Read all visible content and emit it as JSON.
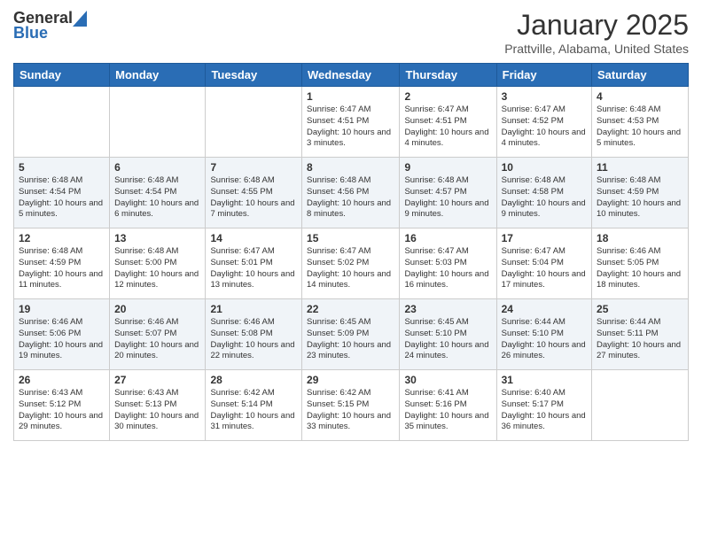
{
  "header": {
    "logo_general": "General",
    "logo_blue": "Blue",
    "month_title": "January 2025",
    "location": "Prattville, Alabama, United States"
  },
  "days_of_week": [
    "Sunday",
    "Monday",
    "Tuesday",
    "Wednesday",
    "Thursday",
    "Friday",
    "Saturday"
  ],
  "weeks": [
    [
      {
        "day": "",
        "info": ""
      },
      {
        "day": "",
        "info": ""
      },
      {
        "day": "",
        "info": ""
      },
      {
        "day": "1",
        "info": "Sunrise: 6:47 AM\nSunset: 4:51 PM\nDaylight: 10 hours\nand 3 minutes."
      },
      {
        "day": "2",
        "info": "Sunrise: 6:47 AM\nSunset: 4:51 PM\nDaylight: 10 hours\nand 4 minutes."
      },
      {
        "day": "3",
        "info": "Sunrise: 6:47 AM\nSunset: 4:52 PM\nDaylight: 10 hours\nand 4 minutes."
      },
      {
        "day": "4",
        "info": "Sunrise: 6:48 AM\nSunset: 4:53 PM\nDaylight: 10 hours\nand 5 minutes."
      }
    ],
    [
      {
        "day": "5",
        "info": "Sunrise: 6:48 AM\nSunset: 4:54 PM\nDaylight: 10 hours\nand 5 minutes."
      },
      {
        "day": "6",
        "info": "Sunrise: 6:48 AM\nSunset: 4:54 PM\nDaylight: 10 hours\nand 6 minutes."
      },
      {
        "day": "7",
        "info": "Sunrise: 6:48 AM\nSunset: 4:55 PM\nDaylight: 10 hours\nand 7 minutes."
      },
      {
        "day": "8",
        "info": "Sunrise: 6:48 AM\nSunset: 4:56 PM\nDaylight: 10 hours\nand 8 minutes."
      },
      {
        "day": "9",
        "info": "Sunrise: 6:48 AM\nSunset: 4:57 PM\nDaylight: 10 hours\nand 9 minutes."
      },
      {
        "day": "10",
        "info": "Sunrise: 6:48 AM\nSunset: 4:58 PM\nDaylight: 10 hours\nand 9 minutes."
      },
      {
        "day": "11",
        "info": "Sunrise: 6:48 AM\nSunset: 4:59 PM\nDaylight: 10 hours\nand 10 minutes."
      }
    ],
    [
      {
        "day": "12",
        "info": "Sunrise: 6:48 AM\nSunset: 4:59 PM\nDaylight: 10 hours\nand 11 minutes."
      },
      {
        "day": "13",
        "info": "Sunrise: 6:48 AM\nSunset: 5:00 PM\nDaylight: 10 hours\nand 12 minutes."
      },
      {
        "day": "14",
        "info": "Sunrise: 6:47 AM\nSunset: 5:01 PM\nDaylight: 10 hours\nand 13 minutes."
      },
      {
        "day": "15",
        "info": "Sunrise: 6:47 AM\nSunset: 5:02 PM\nDaylight: 10 hours\nand 14 minutes."
      },
      {
        "day": "16",
        "info": "Sunrise: 6:47 AM\nSunset: 5:03 PM\nDaylight: 10 hours\nand 16 minutes."
      },
      {
        "day": "17",
        "info": "Sunrise: 6:47 AM\nSunset: 5:04 PM\nDaylight: 10 hours\nand 17 minutes."
      },
      {
        "day": "18",
        "info": "Sunrise: 6:46 AM\nSunset: 5:05 PM\nDaylight: 10 hours\nand 18 minutes."
      }
    ],
    [
      {
        "day": "19",
        "info": "Sunrise: 6:46 AM\nSunset: 5:06 PM\nDaylight: 10 hours\nand 19 minutes."
      },
      {
        "day": "20",
        "info": "Sunrise: 6:46 AM\nSunset: 5:07 PM\nDaylight: 10 hours\nand 20 minutes."
      },
      {
        "day": "21",
        "info": "Sunrise: 6:46 AM\nSunset: 5:08 PM\nDaylight: 10 hours\nand 22 minutes."
      },
      {
        "day": "22",
        "info": "Sunrise: 6:45 AM\nSunset: 5:09 PM\nDaylight: 10 hours\nand 23 minutes."
      },
      {
        "day": "23",
        "info": "Sunrise: 6:45 AM\nSunset: 5:10 PM\nDaylight: 10 hours\nand 24 minutes."
      },
      {
        "day": "24",
        "info": "Sunrise: 6:44 AM\nSunset: 5:10 PM\nDaylight: 10 hours\nand 26 minutes."
      },
      {
        "day": "25",
        "info": "Sunrise: 6:44 AM\nSunset: 5:11 PM\nDaylight: 10 hours\nand 27 minutes."
      }
    ],
    [
      {
        "day": "26",
        "info": "Sunrise: 6:43 AM\nSunset: 5:12 PM\nDaylight: 10 hours\nand 29 minutes."
      },
      {
        "day": "27",
        "info": "Sunrise: 6:43 AM\nSunset: 5:13 PM\nDaylight: 10 hours\nand 30 minutes."
      },
      {
        "day": "28",
        "info": "Sunrise: 6:42 AM\nSunset: 5:14 PM\nDaylight: 10 hours\nand 31 minutes."
      },
      {
        "day": "29",
        "info": "Sunrise: 6:42 AM\nSunset: 5:15 PM\nDaylight: 10 hours\nand 33 minutes."
      },
      {
        "day": "30",
        "info": "Sunrise: 6:41 AM\nSunset: 5:16 PM\nDaylight: 10 hours\nand 35 minutes."
      },
      {
        "day": "31",
        "info": "Sunrise: 6:40 AM\nSunset: 5:17 PM\nDaylight: 10 hours\nand 36 minutes."
      },
      {
        "day": "",
        "info": ""
      }
    ]
  ]
}
